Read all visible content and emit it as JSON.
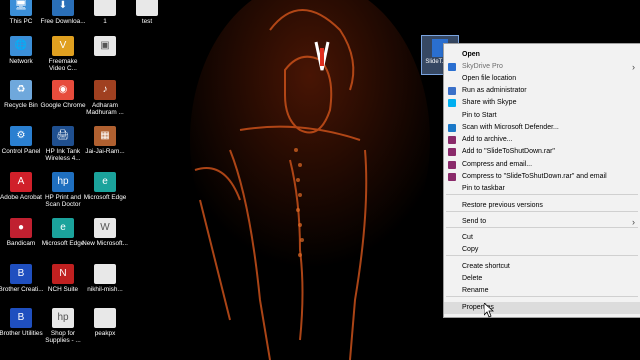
{
  "desktop_icons": [
    {
      "id": "this-pc",
      "label": "This PC",
      "color": "#3b8fd8",
      "glyph": "🖥"
    },
    {
      "id": "free-download",
      "label": "Free Downloa...",
      "color": "#2a6fb8",
      "glyph": "⬇"
    },
    {
      "id": "file-1",
      "label": "1",
      "color": "#e8e8e8",
      "glyph": ""
    },
    {
      "id": "file-test",
      "label": "test",
      "color": "#e8e8e8",
      "glyph": ""
    },
    {
      "id": "network",
      "label": "Network",
      "color": "#3b8fd8",
      "glyph": "🌐"
    },
    {
      "id": "freemake",
      "label": "Freemake Video C...",
      "color": "#e0a020",
      "glyph": "V"
    },
    {
      "id": "file-pdf",
      "label": "",
      "color": "#e8e8e8",
      "glyph": "▣"
    },
    {
      "id": "recycle-bin",
      "label": "Recycle Bin",
      "color": "#6fa8dc",
      "glyph": "♻"
    },
    {
      "id": "chrome",
      "label": "Google Chrome",
      "color": "#e74c3c",
      "glyph": "◉"
    },
    {
      "id": "adharam",
      "label": "Adharam Madhuram ...",
      "color": "#a04020",
      "glyph": "♪"
    },
    {
      "id": "control-panel",
      "label": "Control Panel",
      "color": "#2a7fd0",
      "glyph": "⚙"
    },
    {
      "id": "hp-ink-tank",
      "label": "HP Ink Tank Wireless 4...",
      "color": "#1f4f8f",
      "glyph": "🖨"
    },
    {
      "id": "jai-jai-ram",
      "label": "Jai-Jai-Ram...",
      "color": "#b06030",
      "glyph": "▦"
    },
    {
      "id": "adobe-acrobat",
      "label": "Adobe Acrobat",
      "color": "#d0202a",
      "glyph": "A"
    },
    {
      "id": "hp-print-scan",
      "label": "HP Print and Scan Doctor",
      "color": "#1f6fbf",
      "glyph": "hp"
    },
    {
      "id": "ms-edge-1",
      "label": "Microsoft Edge",
      "color": "#1ba39c",
      "glyph": "e"
    },
    {
      "id": "bandicam",
      "label": "Bandicam",
      "color": "#c02030",
      "glyph": "●"
    },
    {
      "id": "ms-edge-2",
      "label": "Microsoft Edge",
      "color": "#1ba39c",
      "glyph": "e"
    },
    {
      "id": "new-microsoft",
      "label": "New Microsoft...",
      "color": "#e8e8e8",
      "glyph": "W"
    },
    {
      "id": "brother-creative",
      "label": "Brother Creati...",
      "color": "#1f4fbf",
      "glyph": "B"
    },
    {
      "id": "nch-suite",
      "label": "NCH Suite",
      "color": "#c02020",
      "glyph": "N"
    },
    {
      "id": "nikhil-mish",
      "label": "nikhil-mish...",
      "color": "#e8e8e8",
      "glyph": ""
    },
    {
      "id": "brother-utilities",
      "label": "Brother Utilities",
      "color": "#1f4fbf",
      "glyph": "B"
    },
    {
      "id": "shop-supplies",
      "label": "Shop for Supplies - ...",
      "color": "#e8e8e8",
      "glyph": "hp"
    },
    {
      "id": "peakpx",
      "label": "peakpx",
      "color": "#e8e8e8",
      "glyph": ""
    }
  ],
  "selected_file": {
    "label": "SlideT... ov"
  },
  "context_menu": {
    "items": [
      {
        "label": "Open",
        "bold": true,
        "icon": null
      },
      {
        "label": "SkyDrive Pro",
        "disabled": true,
        "icon": "#2a6fd0",
        "submenu": true
      },
      {
        "label": "Open file location",
        "icon": null
      },
      {
        "label": "Run as administrator",
        "icon": "#3a70c8"
      },
      {
        "label": "Share with Skype",
        "icon": "#00aff0"
      },
      {
        "label": "Pin to Start",
        "icon": null
      },
      {
        "label": "Scan with Microsoft Defender...",
        "icon": "#1a78c8"
      },
      {
        "label": "Add to archive...",
        "icon": "#8a2a6a"
      },
      {
        "label": "Add to \"SlideToShutDown.rar\"",
        "icon": "#8a2a6a"
      },
      {
        "label": "Compress and email...",
        "icon": "#8a2a6a"
      },
      {
        "label": "Compress to \"SlideToShutDown.rar\" and email",
        "icon": "#8a2a6a"
      },
      {
        "label": "Pin to taskbar",
        "icon": null
      },
      {
        "label": "Restore previous versions",
        "icon": null
      },
      {
        "label": "Send to",
        "icon": null,
        "submenu": true
      },
      {
        "label": "Cut",
        "icon": null
      },
      {
        "label": "Copy",
        "icon": null
      },
      {
        "label": "Create shortcut",
        "icon": null
      },
      {
        "label": "Delete",
        "icon": null
      },
      {
        "label": "Rename",
        "icon": null
      },
      {
        "label": "Properties",
        "icon": null,
        "hover": true
      }
    ]
  },
  "colors": {
    "menu_bg": "#f2f2f2",
    "hover": "#dcdcdc",
    "wallpaper_glow": "#d4561a"
  }
}
